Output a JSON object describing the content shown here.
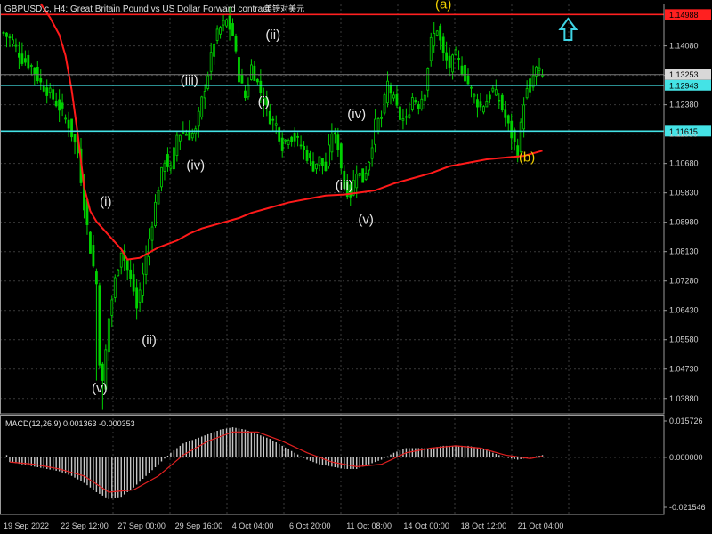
{
  "header": {
    "symbol_label": "GBPUSD.c, H4:",
    "description": "Great Britain Pound vs US Dollar Forward contract",
    "extra": "英镑对美元"
  },
  "colors": {
    "background": "#000000",
    "candle": "#00d200",
    "grid": "#3a3a3a",
    "ma": "#ff1a1a",
    "hline": "#44e3e6",
    "resistance": "#ff2020",
    "wave_white": "#e8e8e8",
    "wave_yellow": "#f0d000",
    "arrow": "#3fd3e3",
    "macd_hist": "#c8c8c8",
    "macd_signal": "#e02020",
    "price_text": "#d0d0d0",
    "frame": "#9a9a9a"
  },
  "chart_data": {
    "type": "candlestick",
    "timeframe": "H4",
    "price_axis": {
      "ylim": [
        1.03436,
        1.1528
      ],
      "ticks": [
        "1.14080",
        "1.13230",
        "1.12380",
        "1.11530",
        "1.10680",
        "1.09830",
        "1.08980",
        "1.08130",
        "1.07280",
        "1.06430",
        "1.05580",
        "1.04730",
        "1.03880"
      ]
    },
    "time_labels": [
      "19 Sep 2022",
      "22 Sep 12:00",
      "27 Sep 00:00",
      "29 Sep 16:00",
      "4 Oct 04:00",
      "6 Oct 20:00",
      "11 Oct 08:00",
      "14 Oct 00:00",
      "18 Oct 12:00",
      "21 Oct 04:00"
    ],
    "close_path": [
      [
        0,
        1.1445
      ],
      [
        3,
        1.142
      ],
      [
        6,
        1.137
      ],
      [
        9,
        1.135
      ],
      [
        12,
        1.13
      ],
      [
        15,
        1.127
      ],
      [
        18,
        1.123
      ],
      [
        21,
        1.118
      ],
      [
        24,
        1.11
      ],
      [
        26,
        1.095
      ],
      [
        28,
        1.082
      ],
      [
        30,
        1.072
      ],
      [
        31,
        1.05
      ],
      [
        32,
        1.043
      ],
      [
        34,
        1.062
      ],
      [
        36,
        1.073
      ],
      [
        38,
        1.082
      ],
      [
        40,
        1.076
      ],
      [
        42,
        1.07
      ],
      [
        43,
        1.065
      ],
      [
        44,
        1.07
      ],
      [
        46,
        1.08
      ],
      [
        48,
        1.09
      ],
      [
        50,
        1.1
      ],
      [
        52,
        1.108
      ],
      [
        54,
        1.105
      ],
      [
        56,
        1.115
      ],
      [
        58,
        1.116
      ],
      [
        60,
        1.115
      ],
      [
        62,
        1.116
      ],
      [
        64,
        1.125
      ],
      [
        66,
        1.133
      ],
      [
        68,
        1.142
      ],
      [
        70,
        1.146
      ],
      [
        72,
        1.148
      ],
      [
        74,
        1.144
      ],
      [
        76,
        1.132
      ],
      [
        78,
        1.126
      ],
      [
        80,
        1.135
      ],
      [
        82,
        1.13
      ],
      [
        84,
        1.125
      ],
      [
        86,
        1.12
      ],
      [
        88,
        1.118
      ],
      [
        90,
        1.112
      ],
      [
        92,
        1.115
      ],
      [
        94,
        1.114
      ],
      [
        96,
        1.112
      ],
      [
        98,
        1.109
      ],
      [
        100,
        1.106
      ],
      [
        102,
        1.108
      ],
      [
        104,
        1.105
      ],
      [
        106,
        1.116
      ],
      [
        108,
        1.112
      ],
      [
        110,
        1.1
      ],
      [
        112,
        1.098
      ],
      [
        114,
        1.105
      ],
      [
        116,
        1.102
      ],
      [
        118,
        1.108
      ],
      [
        120,
        1.118
      ],
      [
        122,
        1.12
      ],
      [
        124,
        1.13
      ],
      [
        126,
        1.125
      ],
      [
        128,
        1.12
      ],
      [
        130,
        1.119
      ],
      [
        132,
        1.126
      ],
      [
        134,
        1.124
      ],
      [
        136,
        1.128
      ],
      [
        138,
        1.142
      ],
      [
        140,
        1.146
      ],
      [
        142,
        1.138
      ],
      [
        144,
        1.135
      ],
      [
        146,
        1.138
      ],
      [
        148,
        1.134
      ],
      [
        150,
        1.13
      ],
      [
        152,
        1.126
      ],
      [
        154,
        1.123
      ],
      [
        156,
        1.125
      ],
      [
        158,
        1.128
      ],
      [
        160,
        1.125
      ],
      [
        162,
        1.12
      ],
      [
        164,
        1.115
      ],
      [
        166,
        1.11
      ],
      [
        168,
        1.125
      ],
      [
        170,
        1.13
      ],
      [
        172,
        1.134
      ],
      [
        174,
        1.132
      ]
    ],
    "moving_average": [
      [
        12,
        1.153
      ],
      [
        15,
        1.149
      ],
      [
        18,
        1.144
      ],
      [
        20,
        1.138
      ],
      [
        22,
        1.128
      ],
      [
        24,
        1.115
      ],
      [
        26,
        1.1
      ],
      [
        28,
        1.093
      ],
      [
        30,
        1.09
      ],
      [
        34,
        1.086
      ],
      [
        38,
        1.082
      ],
      [
        40,
        1.079
      ],
      [
        44,
        1.0795
      ],
      [
        50,
        1.0825
      ],
      [
        56,
        1.0845
      ],
      [
        60,
        1.0865
      ],
      [
        64,
        1.088
      ],
      [
        70,
        1.0895
      ],
      [
        76,
        1.091
      ],
      [
        80,
        1.0925
      ],
      [
        86,
        1.094
      ],
      [
        92,
        1.0955
      ],
      [
        98,
        1.0965
      ],
      [
        104,
        1.0975
      ],
      [
        110,
        1.0978
      ],
      [
        116,
        1.0985
      ],
      [
        120,
        1.099
      ],
      [
        126,
        1.101
      ],
      [
        132,
        1.1025
      ],
      [
        138,
        1.104
      ],
      [
        144,
        1.106
      ],
      [
        150,
        1.107
      ],
      [
        156,
        1.108
      ],
      [
        162,
        1.1085
      ],
      [
        168,
        1.109
      ],
      [
        174,
        1.1105
      ]
    ],
    "horizontal_lines": [
      {
        "price": 1.14988,
        "label": "1.14988",
        "kind": "resistance"
      },
      {
        "price": 1.12943,
        "label": "1.12943",
        "kind": "level"
      },
      {
        "price": 1.11615,
        "label": "1.11615",
        "kind": "level"
      }
    ],
    "current_price": {
      "price": 1.13253,
      "label": "1.13253"
    },
    "wave_labels": [
      {
        "text": "(i)",
        "bar": 33,
        "price": 1.0945,
        "color": "white"
      },
      {
        "text": "(ii)",
        "bar": 47,
        "price": 1.0545,
        "color": "white"
      },
      {
        "text": "(iii)",
        "bar": 60,
        "price": 1.1296,
        "color": "white"
      },
      {
        "text": "(iv)",
        "bar": 62,
        "price": 1.105,
        "color": "white"
      },
      {
        "text": "(v)",
        "bar": 31,
        "price": 1.0405,
        "color": "white"
      },
      {
        "text": "(i)",
        "bar": 84,
        "price": 1.1234,
        "color": "white"
      },
      {
        "text": "(ii)",
        "bar": 87,
        "price": 1.1427,
        "color": "white"
      },
      {
        "text": "(iii)",
        "bar": 110,
        "price": 1.0993,
        "color": "white"
      },
      {
        "text": "(iv)",
        "bar": 114,
        "price": 1.1198,
        "color": "white"
      },
      {
        "text": "(v)",
        "bar": 117,
        "price": 1.0893,
        "color": "white"
      },
      {
        "text": "(a)",
        "bar": 142,
        "price": 1.1516,
        "color": "yellow"
      },
      {
        "text": "(b)",
        "bar": 169,
        "price": 1.1074,
        "color": "yellow"
      }
    ],
    "arrow": {
      "direction": "up",
      "bar": 182,
      "price": 1.1425
    },
    "macd": {
      "label": "MACD(12,26,9) 0.001363 -0.000353",
      "params": [
        12,
        26,
        9
      ],
      "main": 0.001363,
      "signal": -0.000353,
      "ylim": [
        -0.021546,
        0.015726
      ],
      "ticks": [
        "0.015726",
        "0.000000",
        "-0.021546"
      ],
      "histogram": [
        [
          2,
          -0.002
        ],
        [
          6,
          -0.003
        ],
        [
          10,
          -0.004
        ],
        [
          14,
          -0.005
        ],
        [
          18,
          -0.006
        ],
        [
          22,
          -0.008
        ],
        [
          26,
          -0.011
        ],
        [
          30,
          -0.015
        ],
        [
          34,
          -0.018
        ],
        [
          38,
          -0.017
        ],
        [
          42,
          -0.013
        ],
        [
          46,
          -0.008
        ],
        [
          50,
          -0.003
        ],
        [
          54,
          0.002
        ],
        [
          58,
          0.006
        ],
        [
          62,
          0.008
        ],
        [
          66,
          0.01
        ],
        [
          70,
          0.012
        ],
        [
          74,
          0.013
        ],
        [
          78,
          0.012
        ],
        [
          82,
          0.01
        ],
        [
          86,
          0.008
        ],
        [
          90,
          0.005
        ],
        [
          94,
          0.002
        ],
        [
          98,
          -0.001
        ],
        [
          102,
          -0.003
        ],
        [
          106,
          -0.004
        ],
        [
          110,
          -0.005
        ],
        [
          114,
          -0.005
        ],
        [
          118,
          -0.003
        ],
        [
          122,
          -0.001
        ],
        [
          126,
          0.002
        ],
        [
          130,
          0.004
        ],
        [
          134,
          0.004
        ],
        [
          138,
          0.004
        ],
        [
          142,
          0.005
        ],
        [
          146,
          0.005
        ],
        [
          150,
          0.005
        ],
        [
          154,
          0.004
        ],
        [
          158,
          0.002
        ],
        [
          162,
          0.0
        ],
        [
          166,
          -0.001
        ],
        [
          170,
          0.0
        ],
        [
          174,
          0.001
        ]
      ],
      "signal_line": [
        [
          2,
          -0.002
        ],
        [
          10,
          -0.003
        ],
        [
          18,
          -0.005
        ],
        [
          26,
          -0.008
        ],
        [
          34,
          -0.015
        ],
        [
          42,
          -0.014
        ],
        [
          50,
          -0.008
        ],
        [
          58,
          0.001
        ],
        [
          66,
          0.007
        ],
        [
          74,
          0.011
        ],
        [
          82,
          0.011
        ],
        [
          90,
          0.007
        ],
        [
          98,
          0.002
        ],
        [
          106,
          -0.002
        ],
        [
          114,
          -0.004
        ],
        [
          122,
          -0.003
        ],
        [
          130,
          0.002
        ],
        [
          138,
          0.004
        ],
        [
          146,
          0.005
        ],
        [
          154,
          0.004
        ],
        [
          162,
          0.001
        ],
        [
          170,
          -0.0005
        ],
        [
          174,
          0.0005
        ]
      ]
    }
  }
}
